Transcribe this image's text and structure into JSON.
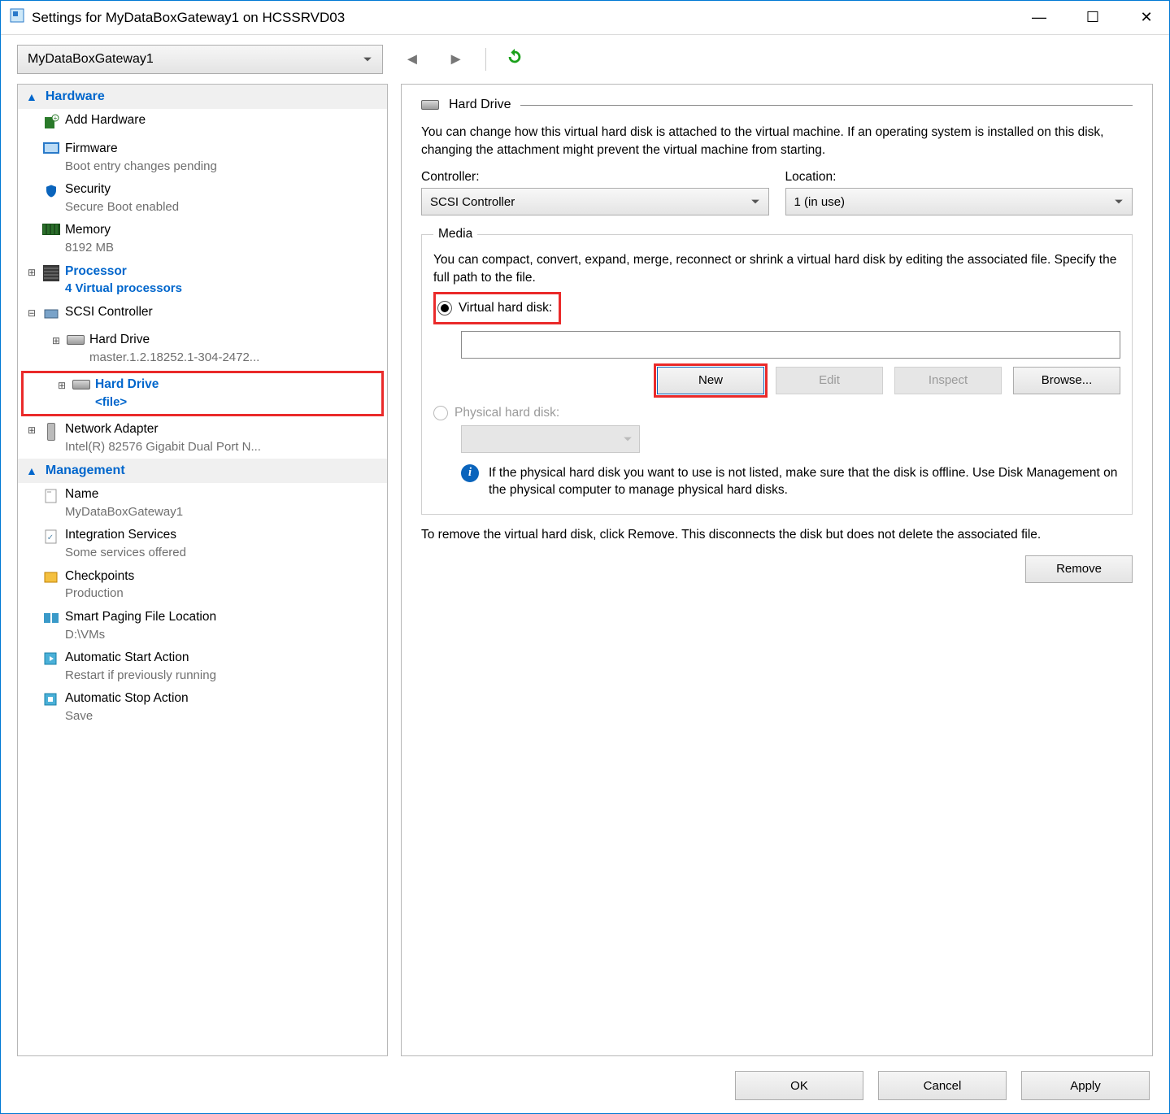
{
  "window": {
    "title": "Settings for MyDataBoxGateway1 on HCSSRVD03"
  },
  "vm_selector": {
    "value": "MyDataBoxGateway1"
  },
  "sidebar": {
    "categories": [
      {
        "name": "Hardware",
        "items": [
          {
            "label": "Add Hardware",
            "sub": ""
          },
          {
            "label": "Firmware",
            "sub": "Boot entry changes pending"
          },
          {
            "label": "Security",
            "sub": "Secure Boot enabled"
          },
          {
            "label": "Memory",
            "sub": "8192 MB"
          },
          {
            "label": "Processor",
            "sub": "4 Virtual processors",
            "link": true,
            "expander": "+"
          },
          {
            "label": "SCSI Controller",
            "sub": "",
            "expander": "-",
            "children": [
              {
                "label": "Hard Drive",
                "sub": "master.1.2.18252.1-304-2472...",
                "expander": "+",
                "indent": 2
              },
              {
                "label": "Hard Drive",
                "sub": "<file>",
                "expander": "+",
                "indent": 2,
                "selected": true,
                "box": true
              }
            ]
          },
          {
            "label": "Network Adapter",
            "sub": "Intel(R) 82576 Gigabit Dual Port N...",
            "expander": "+"
          }
        ]
      },
      {
        "name": "Management",
        "items": [
          {
            "label": "Name",
            "sub": "MyDataBoxGateway1"
          },
          {
            "label": "Integration Services",
            "sub": "Some services offered"
          },
          {
            "label": "Checkpoints",
            "sub": "Production"
          },
          {
            "label": "Smart Paging File Location",
            "sub": "D:\\VMs"
          },
          {
            "label": "Automatic Start Action",
            "sub": "Restart if previously running"
          },
          {
            "label": "Automatic Stop Action",
            "sub": "Save"
          }
        ]
      }
    ]
  },
  "panel": {
    "title": "Hard Drive",
    "description": "You can change how this virtual hard disk is attached to the virtual machine. If an operating system is installed on this disk, changing the attachment might prevent the virtual machine from starting.",
    "controller_label": "Controller:",
    "controller_value": "SCSI Controller",
    "location_label": "Location:",
    "location_value": "1 (in use)",
    "media_legend": "Media",
    "media_description": "You can compact, convert, expand, merge, reconnect or shrink a virtual hard disk by editing the associated file. Specify the full path to the file.",
    "vhd_radio_label": "Virtual hard disk:",
    "vhd_path": "",
    "buttons": {
      "new": "New",
      "edit": "Edit",
      "inspect": "Inspect",
      "browse": "Browse..."
    },
    "phys_radio_label": "Physical hard disk:",
    "phys_info": "If the physical hard disk you want to use is not listed, make sure that the disk is offline. Use Disk Management on the physical computer to manage physical hard disks.",
    "remove_text": "To remove the virtual hard disk, click Remove. This disconnects the disk but does not delete the associated file.",
    "remove_btn": "Remove"
  },
  "footer": {
    "ok": "OK",
    "cancel": "Cancel",
    "apply": "Apply"
  }
}
